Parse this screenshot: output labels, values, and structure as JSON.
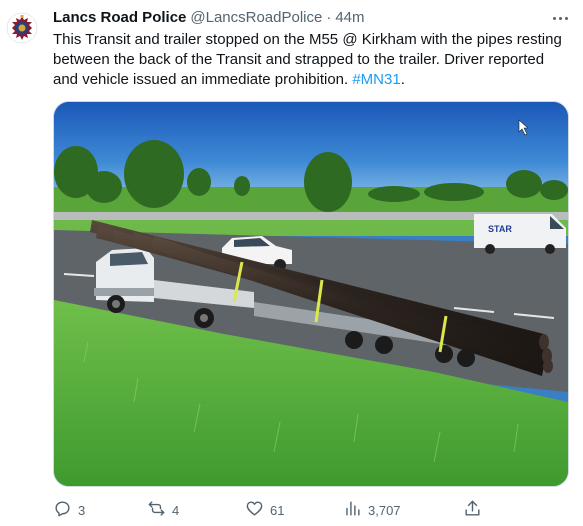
{
  "tweet": {
    "display_name": "Lancs Road Police",
    "handle": "@LancsRoadPolice",
    "separator": "·",
    "time": "44m",
    "text_main": "This Transit and trailer stopped on the M55 @ Kirkham with the pipes resting between the back of the Transit and strapped to the trailer. Driver reported and vehicle issued an immediate prohibition. ",
    "hashtag": "#MN31",
    "text_end": ".",
    "image_van_text": "STAR"
  },
  "actions": {
    "replies": "3",
    "retweets": "4",
    "likes": "61",
    "views": "3,707"
  },
  "icons": {
    "avatar": "police-crest-icon",
    "more": "more-options-icon",
    "reply": "reply-icon",
    "retweet": "retweet-icon",
    "like": "heart-icon",
    "views": "views-icon",
    "share": "share-icon"
  },
  "colors": {
    "text": "#0f1419",
    "secondary": "#536471",
    "link": "#1d9bf0"
  }
}
